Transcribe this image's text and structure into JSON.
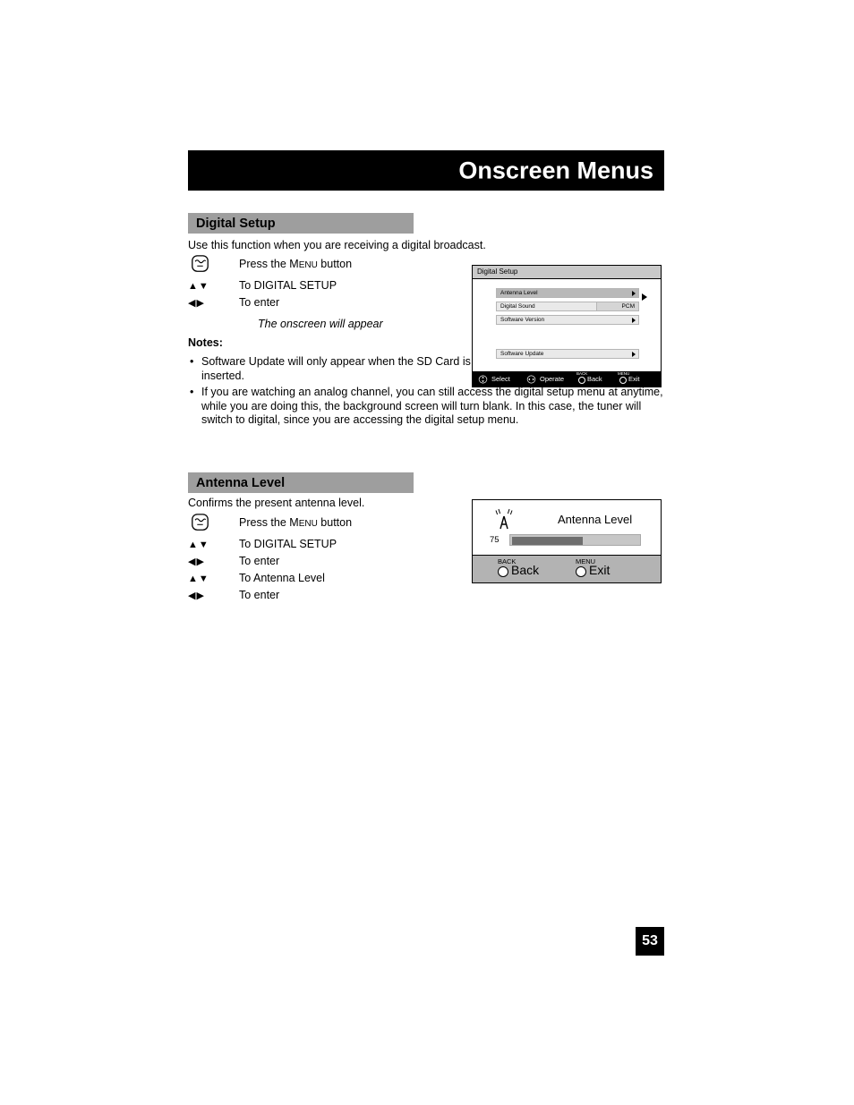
{
  "header": {
    "title": "Onscreen Menus"
  },
  "sections": {
    "digital_setup": {
      "bar_label": "Digital Setup",
      "intro": "Use this function when you are receiving a digital broadcast.",
      "steps": [
        {
          "icon": "menu-button-icon",
          "text_pre": "Press the M",
          "text_sc": "ENU",
          "text_post": " button"
        },
        {
          "icon": "updown-arrows",
          "text": "To DIGITAL SETUP"
        },
        {
          "icon": "leftright-arrows",
          "text": "To enter"
        }
      ],
      "onscreen_note": "The onscreen will appear",
      "notes_heading": "Notes:",
      "notes": [
        "Software Update will only appear when the SD Card is inserted.",
        "If you are watching an analog channel, you can still access the digital setup menu at anytime, while you are doing this, the background screen will turn blank.  In this case, the tuner will switch to digital, since you are accessing the digital setup menu."
      ]
    },
    "antenna_level": {
      "bar_label": "Antenna Level",
      "intro": "Confirms the present antenna level.",
      "steps": [
        {
          "icon": "menu-button-icon",
          "text_pre": "Press the M",
          "text_sc": "ENU",
          "text_post": " button"
        },
        {
          "icon": "updown-arrows",
          "text": "To DIGITAL SETUP"
        },
        {
          "icon": "leftright-arrows",
          "text": "To enter"
        },
        {
          "icon": "updown-arrows",
          "text": "To Antenna Level"
        },
        {
          "icon": "leftright-arrows",
          "text": "To enter"
        }
      ]
    }
  },
  "osd_digital_setup": {
    "title": "Digital Setup",
    "rows": [
      {
        "label": "Antenna Level",
        "value": "",
        "arrow": true,
        "selected": true
      },
      {
        "label": "Digital Sound",
        "value": "PCM",
        "arrow": false,
        "selected": false
      },
      {
        "label": "Software Version",
        "value": "",
        "arrow": true,
        "selected": false
      },
      {
        "label": "Software Update",
        "value": "",
        "arrow": true,
        "selected": false
      }
    ],
    "footer": [
      {
        "icon": "dpad-updown-icon",
        "label": "Select",
        "tiny": ""
      },
      {
        "icon": "dpad-leftright-icon",
        "label": "Operate",
        "tiny": ""
      },
      {
        "icon": "circle-button-icon",
        "label": "Back",
        "tiny": "BACK"
      },
      {
        "icon": "circle-button-icon",
        "label": "Exit",
        "tiny": "MENU"
      }
    ]
  },
  "osd_antenna_level": {
    "title": "Antenna Level",
    "icon": "antenna-icon",
    "value": "75",
    "fill_percent": 55,
    "footer": [
      {
        "tiny": "BACK",
        "label": "Back",
        "icon": "circle-button-icon"
      },
      {
        "tiny": "MENU",
        "label": "Exit",
        "icon": "circle-button-icon"
      }
    ]
  },
  "page_number": "53",
  "arrows": {
    "updown": "▲▼",
    "leftright": "◀▶"
  },
  "bullet": "•"
}
